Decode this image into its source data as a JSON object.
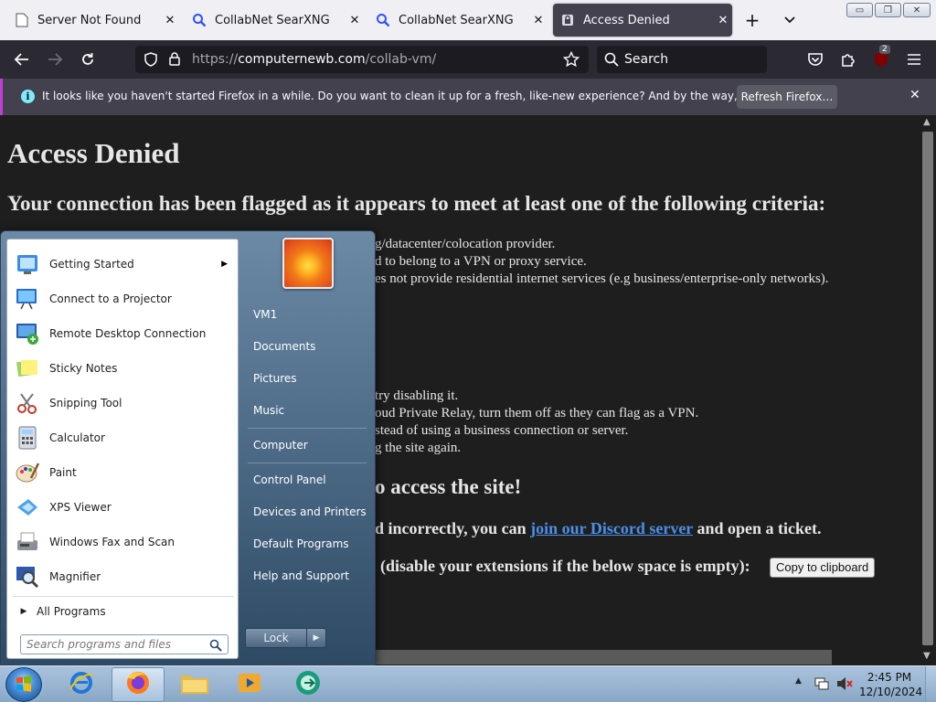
{
  "browser": {
    "tabs": [
      {
        "title": "Server Not Found",
        "icon": "page-icon",
        "active": false
      },
      {
        "title": "CollabNet SearXNG",
        "icon": "search-icon",
        "active": false
      },
      {
        "title": "CollabNet SearXNG",
        "icon": "search-icon",
        "active": false
      },
      {
        "title": "Access Denied",
        "icon": "lock-page-icon",
        "active": true
      }
    ],
    "new_tab": "+",
    "tab_list": "⌄",
    "url_scheme": "https://",
    "url_host": "computernewb.com",
    "url_path": "/collab-vm/",
    "search_placeholder": "Search",
    "extension_badge": "2",
    "notification": {
      "text": "It looks like you haven't started Firefox in a while. Do you want to clean it up for a fresh, like-new experience? And by the way, welcome back!",
      "button": "Refresh Firefox…",
      "close": "✕"
    }
  },
  "page": {
    "title": "Access Denied",
    "subtitle": "Your connection has been flagged as it appears to meet at least one of the following criteria:",
    "criteria": [
      "g/datacenter/colocation provider.",
      "d to belong to a VPN or proxy service.",
      "es not provide residential internet services (e.g business/enterprise-only networks)."
    ],
    "steps": [
      "try disabling it.",
      "oud Private Relay, turn them off as they can flag as a VPN.",
      "stead of using a business connection or server.",
      "g the site again."
    ],
    "access_heading": "o access the site!",
    "ticket_prefix": "d incorrectly, you can ",
    "ticket_link": "join our Discord server",
    "ticket_suffix": " and open a ticket.",
    "extensions_note": "(disable your extensions if the below space is empty):",
    "copy_button": "Copy to clipboard"
  },
  "start_menu": {
    "programs": [
      {
        "label": "Getting Started",
        "icon": "getting-started-icon",
        "submenu": true
      },
      {
        "label": "Connect to a Projector",
        "icon": "projector-icon",
        "submenu": false
      },
      {
        "label": "Remote Desktop Connection",
        "icon": "remote-desktop-icon",
        "submenu": false
      },
      {
        "label": "Sticky Notes",
        "icon": "sticky-notes-icon",
        "submenu": false
      },
      {
        "label": "Snipping Tool",
        "icon": "scissors-icon",
        "submenu": false
      },
      {
        "label": "Calculator",
        "icon": "calculator-icon",
        "submenu": false
      },
      {
        "label": "Paint",
        "icon": "paint-palette-icon",
        "submenu": false
      },
      {
        "label": "XPS Viewer",
        "icon": "xps-viewer-icon",
        "submenu": false
      },
      {
        "label": "Windows Fax and Scan",
        "icon": "fax-icon",
        "submenu": false
      },
      {
        "label": "Magnifier",
        "icon": "magnifier-icon",
        "submenu": false
      }
    ],
    "all_programs": "All Programs",
    "search_placeholder": "Search programs and files",
    "right_items": [
      "VM1",
      "Documents",
      "Pictures",
      "Music",
      "Computer",
      "Control Panel",
      "Devices and Printers",
      "Default Programs",
      "Help and Support"
    ],
    "lock_label": "Lock"
  },
  "taskbar": {
    "apps": [
      "internet-explorer-icon",
      "firefox-icon",
      "explorer-folder-icon",
      "media-player-icon",
      "connect-icon"
    ],
    "time": "2:45 PM",
    "date": "12/10/2024"
  }
}
